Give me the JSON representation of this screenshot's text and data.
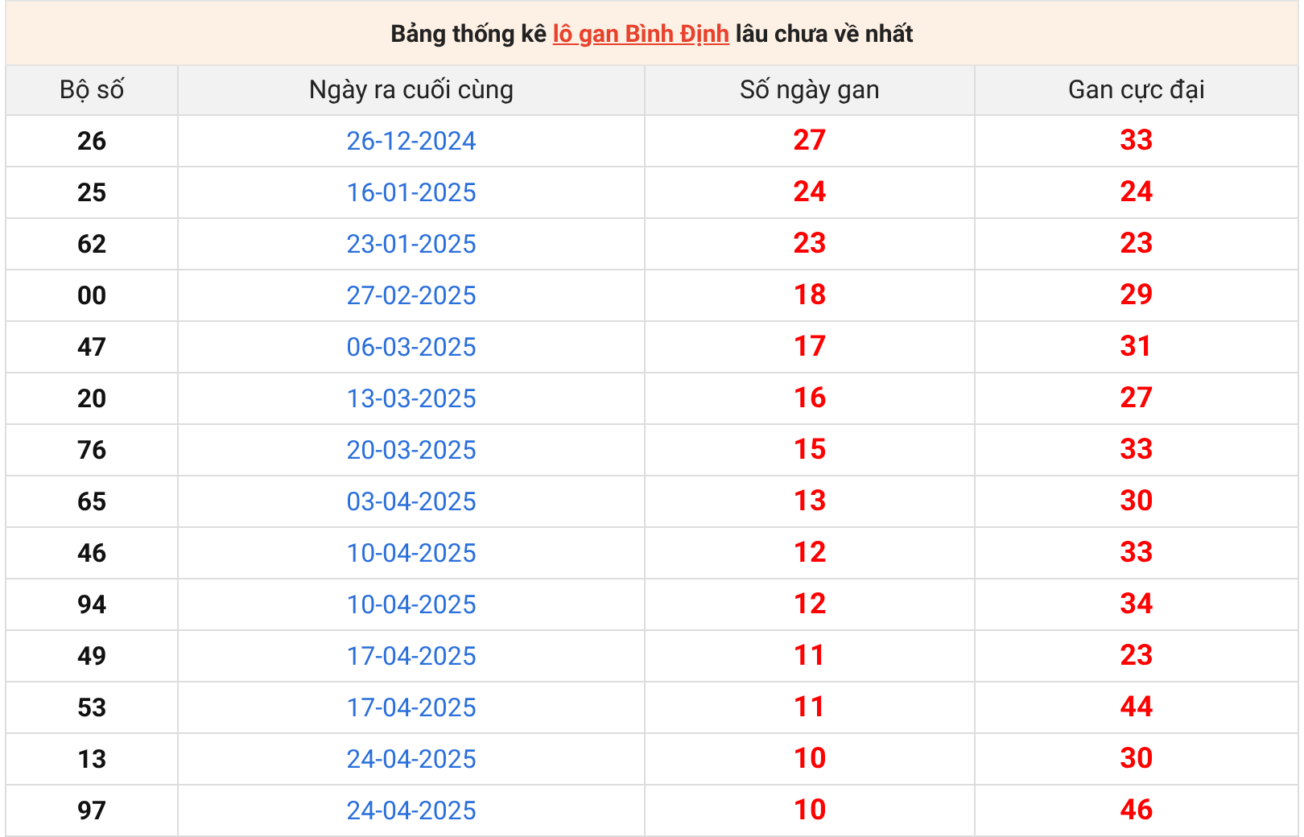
{
  "caption": {
    "before": "Bảng thống kê",
    "link": "lô gan Bình Định",
    "after": "lâu chưa về nhất"
  },
  "columns": [
    "Bộ số",
    "Ngày ra cuối cùng",
    "Số ngày gan",
    "Gan cực đại"
  ],
  "rows": [
    [
      "26",
      "26-12-2024",
      "27",
      "33"
    ],
    [
      "25",
      "16-01-2025",
      "24",
      "24"
    ],
    [
      "62",
      "23-01-2025",
      "23",
      "23"
    ],
    [
      "00",
      "27-02-2025",
      "18",
      "29"
    ],
    [
      "47",
      "06-03-2025",
      "17",
      "31"
    ],
    [
      "20",
      "13-03-2025",
      "16",
      "27"
    ],
    [
      "76",
      "20-03-2025",
      "15",
      "33"
    ],
    [
      "65",
      "03-04-2025",
      "13",
      "30"
    ],
    [
      "46",
      "10-04-2025",
      "12",
      "33"
    ],
    [
      "94",
      "10-04-2025",
      "12",
      "34"
    ],
    [
      "49",
      "17-04-2025",
      "11",
      "23"
    ],
    [
      "53",
      "17-04-2025",
      "11",
      "44"
    ],
    [
      "13",
      "24-04-2025",
      "10",
      "30"
    ],
    [
      "97",
      "24-04-2025",
      "10",
      "46"
    ]
  ]
}
